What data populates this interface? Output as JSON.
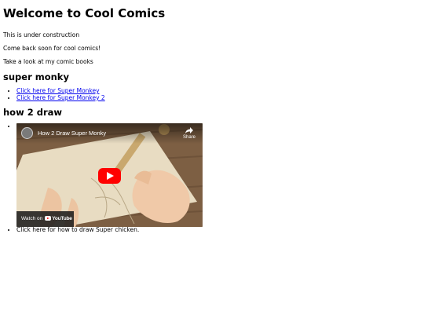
{
  "page": {
    "title": "Welcome to Cool Comics",
    "para1": "This is under construction",
    "para2": "Come back soon for cool comics!",
    "para3": "Take a look at my comic books"
  },
  "section1": {
    "heading": "super monky",
    "links": [
      {
        "label": "Click here for Super Monkey"
      },
      {
        "label": "Click here for Super Monkey 2"
      }
    ]
  },
  "section2": {
    "heading": "how 2 draw",
    "video": {
      "title": "How 2 Draw Super Monky",
      "share_label": "Share",
      "watch_on_label": "Watch on",
      "brand_label": "YouTube",
      "play_color": "#ff0000",
      "icons": [
        "channel-avatar-icon",
        "share-icon",
        "play-icon",
        "youtube-logo-icon"
      ]
    },
    "caption": "Click here for how to draw Super chicken."
  }
}
